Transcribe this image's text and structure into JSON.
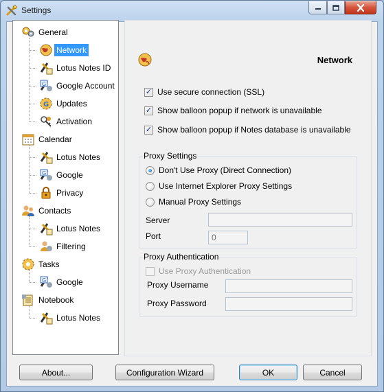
{
  "window": {
    "title": "Settings"
  },
  "tree": {
    "items": [
      {
        "label": "General",
        "icon": "gears-icon",
        "level": 0
      },
      {
        "label": "Network",
        "icon": "globe-network-icon",
        "level": 1,
        "selected": true
      },
      {
        "label": "Lotus Notes ID",
        "icon": "lotus-id-icon",
        "level": 1
      },
      {
        "label": "Google Account",
        "icon": "google-account-icon",
        "level": 1
      },
      {
        "label": "Updates",
        "icon": "updates-gear-icon",
        "level": 1
      },
      {
        "label": "Activation",
        "icon": "activation-key-icon",
        "level": 1
      },
      {
        "label": "Calendar",
        "icon": "calendar-icon",
        "level": 0
      },
      {
        "label": "Lotus Notes",
        "icon": "lotus-notes-icon",
        "level": 1
      },
      {
        "label": "Google",
        "icon": "google-sync-icon",
        "level": 1
      },
      {
        "label": "Privacy",
        "icon": "lock-icon",
        "level": 1
      },
      {
        "label": "Contacts",
        "icon": "contacts-icon",
        "level": 0
      },
      {
        "label": "Lotus Notes",
        "icon": "lotus-notes-icon",
        "level": 1
      },
      {
        "label": "Filtering",
        "icon": "filter-contacts-icon",
        "level": 1
      },
      {
        "label": "Tasks",
        "icon": "tasks-gear-icon",
        "level": 0
      },
      {
        "label": "Google",
        "icon": "google-sync-icon",
        "level": 1
      },
      {
        "label": "Notebook",
        "icon": "notebook-icon",
        "level": 0
      },
      {
        "label": "Lotus Notes",
        "icon": "lotus-notes-icon",
        "level": 1
      }
    ]
  },
  "panel": {
    "title": "Network",
    "checkboxes": [
      {
        "label": "Use secure connection (SSL)",
        "checked": true
      },
      {
        "label": "Show balloon popup if network is unavailable",
        "checked": true
      },
      {
        "label": "Show balloon popup if Notes database is unavailable",
        "checked": true
      }
    ],
    "proxy_settings": {
      "legend": "Proxy Settings",
      "options": [
        {
          "label": "Don't Use Proxy (Direct Connection)",
          "selected": true
        },
        {
          "label": "Use Internet Explorer Proxy Settings",
          "selected": false
        },
        {
          "label": "Manual Proxy Settings",
          "selected": false
        }
      ],
      "server_label": "Server",
      "server_value": "",
      "port_label": "Port",
      "port_value": "0"
    },
    "proxy_auth": {
      "legend": "Proxy Authentication",
      "use_auth_label": "Use Proxy Authentication",
      "use_auth_checked": false,
      "username_label": "Proxy Username",
      "username_value": "",
      "password_label": "Proxy Password",
      "password_value": ""
    }
  },
  "buttons": {
    "about": "About...",
    "wizard": "Configuration Wizard",
    "ok": "OK",
    "cancel": "Cancel"
  },
  "colors": {
    "selection": "#3399ff",
    "close_button": "#c7402a"
  }
}
